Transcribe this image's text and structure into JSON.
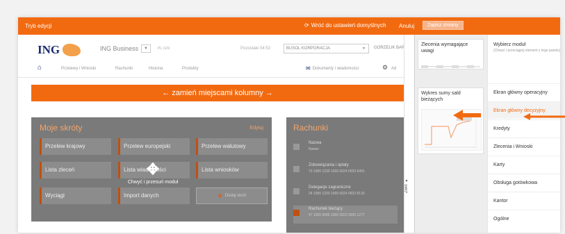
{
  "topbar": {
    "mode_label": "Tryb edycji",
    "reset_label": "Wróć do ustawień domyślnych",
    "cancel_label": "Anuluj",
    "save_label": "Zapisz zmiany"
  },
  "header": {
    "logo_text": "ING",
    "business_label": "ING Business",
    "langs": "PL | EN",
    "session": "Pozostało 04:52",
    "company": "BUSOL KORPORACJA",
    "user": "GORZELIK BARBARA"
  },
  "nav": {
    "items": [
      "Przelewy i Wnioski",
      "Rachunki",
      "Historia",
      "Produkty"
    ],
    "docs_label": "Dokumenty i wiadomości",
    "settings_label": "Ad"
  },
  "swap_bar": "← zamień miejscami kolumny →",
  "shortcuts": {
    "title": "Moje skróty",
    "edit": "Edytuj",
    "tiles": [
      "Przelew krajowy",
      "Przelew europejski",
      "Przelew walutowy",
      "Lista zleceń",
      "Lista wiadomości",
      "Lista wniosków",
      "Wyciągi",
      "Import danych"
    ],
    "add_label": "Dodaj skrót",
    "move_hint": "Chwyć i przesuń moduł"
  },
  "accounts": {
    "title": "Rachunki",
    "rows": [
      {
        "name": "Nazwa",
        "number": "Numer"
      },
      {
        "name": "Zobowiązania i opłaty",
        "number": "73 1050 1230 1000 0024 0920 6491"
      },
      {
        "name": "Delegacje zagraniczne",
        "number": "24 1050 1230 1000 0024 0922 8133"
      },
      {
        "name": "Rachunek bieżący",
        "number": "47 1050 0086 1000 0023 3506 1277"
      }
    ]
  },
  "panel": {
    "card1_title": "Zlecenia wymagające uwagi",
    "card2_title": "Wykres sumy sald bieżących",
    "collapse_label": "Zwiń"
  },
  "menu": {
    "header": "Wybierz moduł",
    "header_sub": "(Chwyć i przeciągnij element z tego panelu)",
    "items": [
      "Ekran główny operacyjny",
      "Ekran główny decyzyjny",
      "Kredyty",
      "Zlecenia i Wnioski",
      "Karty",
      "Obsługa gotówkowa",
      "Kantor",
      "Ogólne"
    ]
  },
  "colors": {
    "accent": "#f26a10",
    "overlay": "#7a7a7a"
  }
}
